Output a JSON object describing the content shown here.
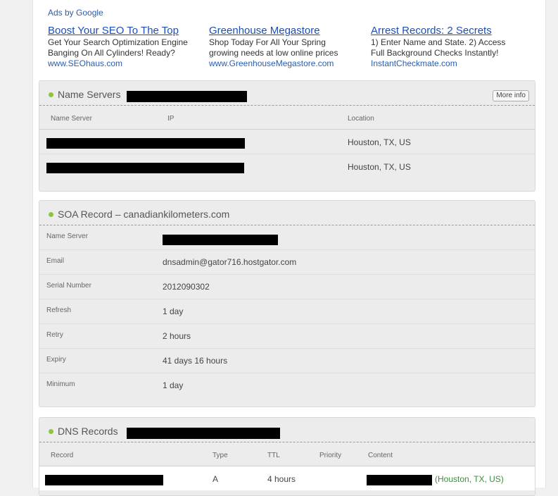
{
  "ads": {
    "label": "Ads by Google",
    "items": [
      {
        "title": "Boost Your SEO To The Top",
        "line1": "Get Your Search Optimization Engine",
        "line2": "Banging On All Cylinders! Ready?",
        "url": "www.SEOhaus.com"
      },
      {
        "title": "Greenhouse Megastore",
        "line1": "Shop Today For All Your Spring",
        "line2": "growing needs at low online prices",
        "url": "www.GreenhouseMegastore.com"
      },
      {
        "title": "Arrest Records: 2 Secrets",
        "line1": "1) Enter Name and State. 2) Access",
        "line2": "Full Background Checks Instantly!",
        "url": "InstantCheckmate.com"
      }
    ]
  },
  "name_servers": {
    "title": "Name Servers",
    "more_info": "More info",
    "columns": [
      "Name Server",
      "IP",
      "Location"
    ],
    "rows": [
      {
        "location": "Houston, TX, US"
      },
      {
        "location": "Houston, TX, US"
      }
    ]
  },
  "soa": {
    "title": "SOA Record – canadiankilometers.com",
    "fields": [
      {
        "label": "Name Server",
        "value": ""
      },
      {
        "label": "Email",
        "value": "dnsadmin@gator716.hostgator.com"
      },
      {
        "label": "Serial Number",
        "value": "2012090302"
      },
      {
        "label": "Refresh",
        "value": "1 day"
      },
      {
        "label": "Retry",
        "value": "2 hours"
      },
      {
        "label": "Expiry",
        "value": "41 days 16 hours"
      },
      {
        "label": "Minimum",
        "value": "1 day"
      }
    ]
  },
  "dns": {
    "title": "DNS Records",
    "columns": [
      "Record",
      "Type",
      "TTL",
      "Priority",
      "Content"
    ],
    "rows": [
      {
        "type": "A",
        "ttl": "4 hours",
        "priority": "",
        "location": "(Houston, TX, US)"
      }
    ]
  },
  "colors": {
    "accent": "#8cc63f",
    "link": "#1d4fb3"
  }
}
